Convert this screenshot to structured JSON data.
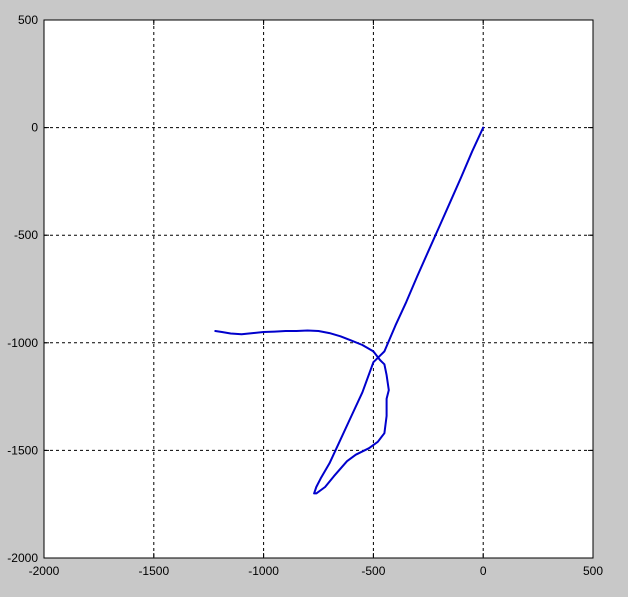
{
  "chart_data": {
    "type": "line",
    "title": "",
    "xlabel": "",
    "ylabel": "",
    "xlim": [
      -2000,
      500
    ],
    "ylim": [
      -2000,
      500
    ],
    "grid": true,
    "grid_style": "dashed",
    "background": "#c8c8c8",
    "plot_background": "#ffffff",
    "x_ticks": [
      -2000,
      -1500,
      -1000,
      -500,
      0,
      500
    ],
    "y_ticks": [
      -2000,
      -1500,
      -1000,
      -500,
      0,
      500
    ],
    "x_tick_labels": [
      "-2000",
      "-1500",
      "-1000",
      "-500",
      "0",
      "500"
    ],
    "y_tick_labels": [
      "-2000",
      "-1500",
      "-1000",
      "-500",
      "0",
      "500"
    ],
    "series": [
      {
        "color": "#0000cc",
        "x": [
          0,
          -50,
          -100,
          -150,
          -200,
          -250,
          -300,
          -350,
          -400,
          -450,
          -500,
          -550,
          -600,
          -650,
          -700,
          -740,
          -760,
          -770,
          -760,
          -720,
          -680,
          -620,
          -580,
          -520,
          -480,
          -450,
          -440,
          -440,
          -430,
          -440,
          -450,
          -470,
          -500,
          -550,
          -600,
          -650,
          -700,
          -750,
          -800,
          -850,
          -900,
          -950,
          -1000,
          -1050,
          -1100,
          -1150,
          -1190,
          -1220
        ],
        "y": [
          0,
          -110,
          -230,
          -345,
          -460,
          -575,
          -690,
          -810,
          -920,
          -1040,
          -1090,
          -1230,
          -1340,
          -1450,
          -1560,
          -1630,
          -1670,
          -1700,
          -1700,
          -1670,
          -1620,
          -1550,
          -1520,
          -1490,
          -1460,
          -1420,
          -1340,
          -1260,
          -1220,
          -1150,
          -1100,
          -1080,
          -1040,
          -1010,
          -990,
          -970,
          -955,
          -945,
          -943,
          -945,
          -945,
          -948,
          -950,
          -955,
          -960,
          -957,
          -950,
          -945
        ]
      }
    ]
  }
}
